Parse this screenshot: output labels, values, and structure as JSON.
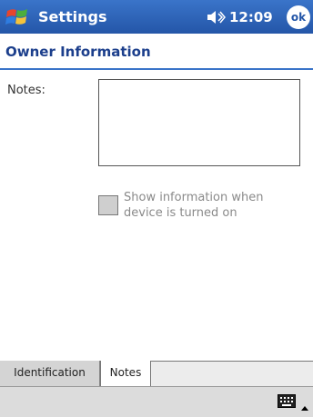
{
  "titlebar": {
    "app_title": "Settings",
    "time": "12:09",
    "ok_label": "ok"
  },
  "page": {
    "title": "Owner Information"
  },
  "form": {
    "notes_label": "Notes:",
    "notes_value": "",
    "show_info_label": "Show information when device is turned on",
    "show_info_checked": false
  },
  "tabs": [
    {
      "label": "Identification",
      "selected": false
    },
    {
      "label": "Notes",
      "selected": true
    }
  ],
  "colors": {
    "titlebar": "#2456a8",
    "accent": "#3a74c9",
    "page_title": "#1c3f8c"
  },
  "icons": {
    "start": "windows-flag-icon",
    "speaker": "speaker-icon",
    "keyboard": "keyboard-icon",
    "sip_arrow": "arrow-up-icon"
  }
}
